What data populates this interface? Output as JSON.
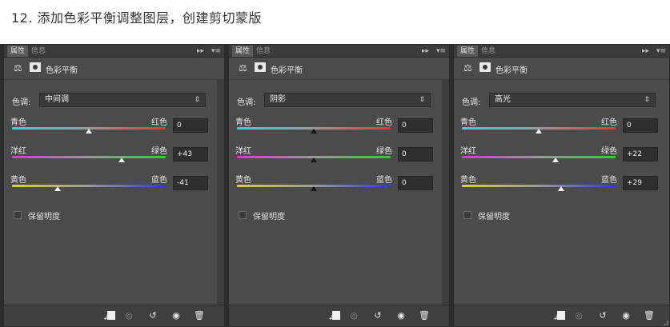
{
  "caption": "12. 添加色彩平衡调整图层，创建剪切蒙版",
  "panel_tabs": {
    "active": "属性",
    "inactive": "信息",
    "expand": "▸▸",
    "menu": "▾≡"
  },
  "panel_title": "色彩平衡",
  "tone_label": "色调:",
  "preserve_label": "保留明度",
  "slider_labels": [
    {
      "left": "青色",
      "right": "红色"
    },
    {
      "left": "洋红",
      "right": "绿色"
    },
    {
      "left": "黄色",
      "right": "蓝色"
    }
  ],
  "colors": {
    "cyan_red": [
      "#3ad3d8",
      "#9a9a9a",
      "#e0383a"
    ],
    "magenta_green": [
      "#d23ad2",
      "#9a9a9a",
      "#34c83a"
    ],
    "yellow_blue": [
      "#d8d23a",
      "#9a9a9a",
      "#3438d6"
    ]
  },
  "panels": [
    {
      "tone": "中间调",
      "sliders": [
        {
          "value_text": "0",
          "position": 0.5,
          "thumb": "light"
        },
        {
          "value_text": "+43",
          "position": 0.715,
          "thumb": "light"
        },
        {
          "value_text": "-41",
          "position": 0.295,
          "thumb": "light"
        }
      ]
    },
    {
      "tone": "阴影",
      "sliders": [
        {
          "value_text": "0",
          "position": 0.5,
          "thumb": "dark"
        },
        {
          "value_text": "0",
          "position": 0.5,
          "thumb": "dark"
        },
        {
          "value_text": "0",
          "position": 0.5,
          "thumb": "dark"
        }
      ]
    },
    {
      "tone": "高光",
      "sliders": [
        {
          "value_text": "0",
          "position": 0.5,
          "thumb": "light"
        },
        {
          "value_text": "+22",
          "position": 0.61,
          "thumb": "light"
        },
        {
          "value_text": "+29",
          "position": 0.645,
          "thumb": "light"
        }
      ]
    }
  ],
  "footer_icons": [
    "clip-to-layer-icon",
    "view-previous-icon",
    "reset-icon",
    "visibility-eye-icon",
    "trash-icon"
  ]
}
